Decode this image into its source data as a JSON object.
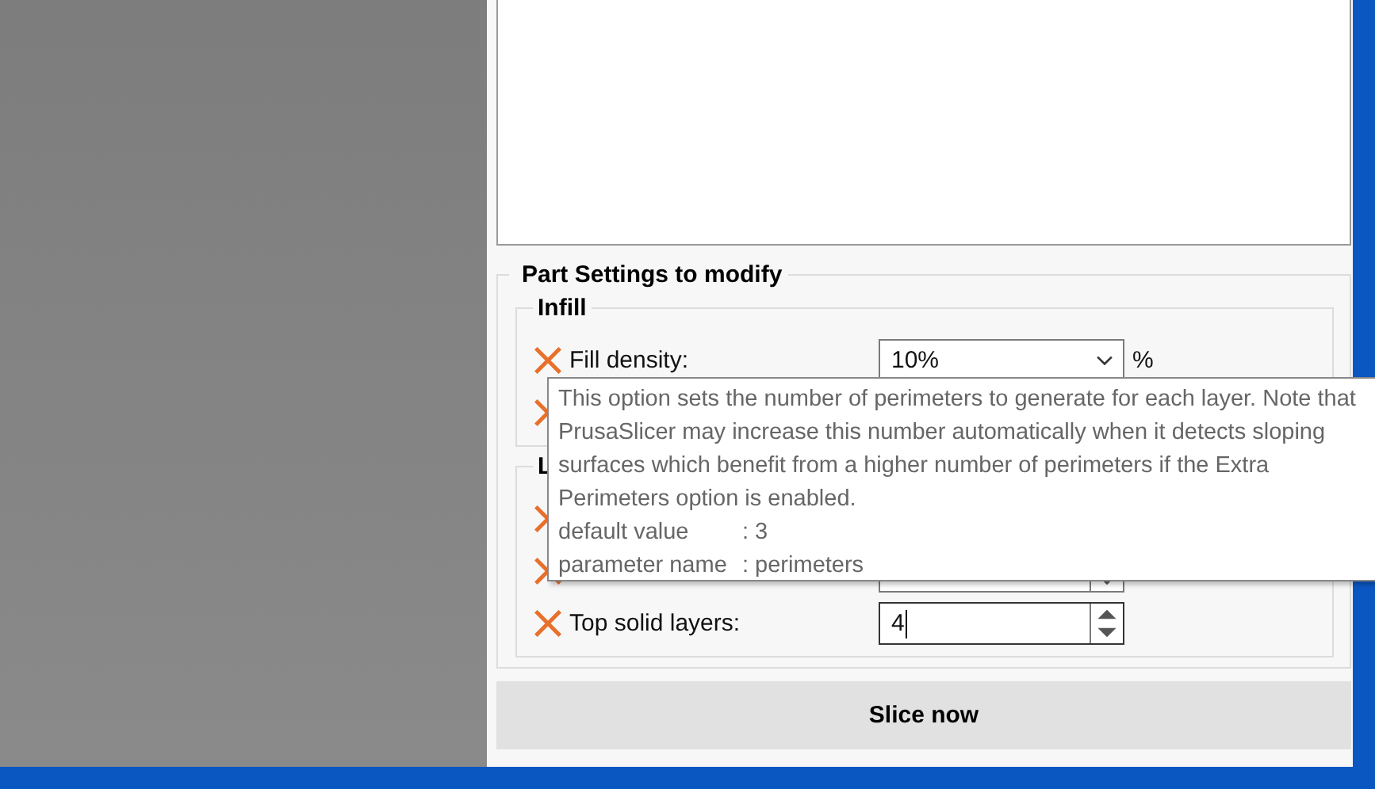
{
  "section": {
    "title": "Part Settings to modify",
    "groups": [
      {
        "title": "Infill",
        "rows": [
          {
            "kind": "dropdown",
            "label": "Fill density:",
            "value": "10%",
            "unit": "%"
          },
          {
            "kind": "covered"
          }
        ]
      },
      {
        "title": "L",
        "rows": [
          {
            "kind": "covered"
          },
          {
            "kind": "covered-spin"
          },
          {
            "kind": "spin",
            "label": "Top solid layers:",
            "value": "4",
            "focused": true
          }
        ]
      }
    ]
  },
  "tooltip": {
    "description": "This option sets the number of perimeters to generate for each layer. Note that PrusaSlicer may increase this number automatically when it detects sloping surfaces which benefit from a higher number of perimeters if the Extra Perimeters option is enabled.",
    "details": [
      {
        "key": "default value",
        "value": ": 3"
      },
      {
        "key": "parameter name",
        "value": ": perimeters"
      }
    ]
  },
  "button": "Slice now"
}
